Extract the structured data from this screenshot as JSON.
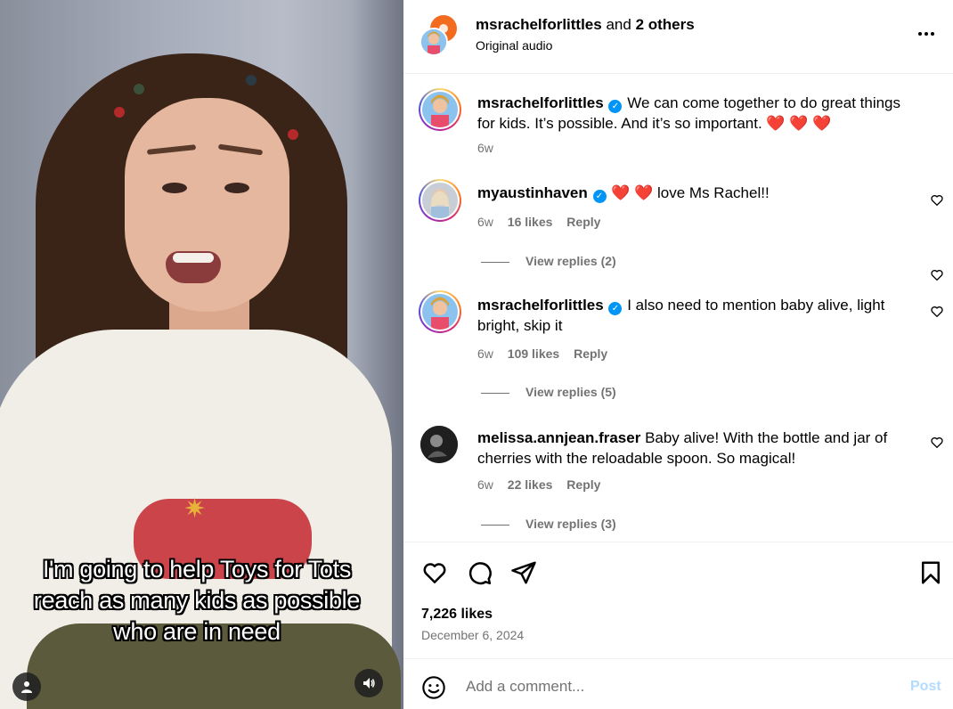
{
  "video": {
    "caption": "I'm going to help Toys for Tots reach as many kids as possible who are in need",
    "profile_icon": "user-icon",
    "sound_icon": "volume-icon"
  },
  "header": {
    "username": "msrachelforlittles",
    "and_text": "and",
    "others": "2 others",
    "subtitle": "Original audio",
    "more_icon": "more-horizontal-icon"
  },
  "caption_post": {
    "username": "msrachelforlittles",
    "text": "We can come together to do great things for kids. It’s possible. And it’s so important. ❤️ ❤️ ❤️",
    "time": "6w"
  },
  "comments": [
    {
      "username": "myaustinhaven",
      "verified": true,
      "text": "❤️ ❤️ love Ms Rachel!!",
      "time": "6w",
      "likes": "16 likes",
      "reply": "Reply",
      "view_replies": "View replies (2)"
    },
    {
      "username": "msrachelforlittles",
      "verified": true,
      "text": "I also need to mention baby alive, light bright, skip it",
      "time": "6w",
      "likes": "109 likes",
      "reply": "Reply",
      "view_replies": "View replies (5)"
    },
    {
      "username": "melissa.annjean.fraser",
      "verified": false,
      "text": "Baby alive! With the bottle and jar of cherries with the reloadable spoon. So magical!",
      "time": "6w",
      "likes": "22 likes",
      "reply": "Reply",
      "view_replies": "View replies (3)"
    }
  ],
  "actions": {
    "like_icon": "heart-icon",
    "comment_icon": "comment-icon",
    "share_icon": "send-icon",
    "save_icon": "bookmark-icon",
    "likes_count": "7,226 likes",
    "date": "December 6, 2024"
  },
  "composer": {
    "placeholder": "Add a comment...",
    "post_label": "Post",
    "emoji_icon": "emoji-icon"
  },
  "colors": {
    "verified": "#0095f6",
    "post_disabled": "#b3dbff",
    "secondary_text": "#737373",
    "story_ring": [
      "#feda75",
      "#fa7e1e",
      "#d62976",
      "#962fbf",
      "#4f5bd5"
    ]
  }
}
